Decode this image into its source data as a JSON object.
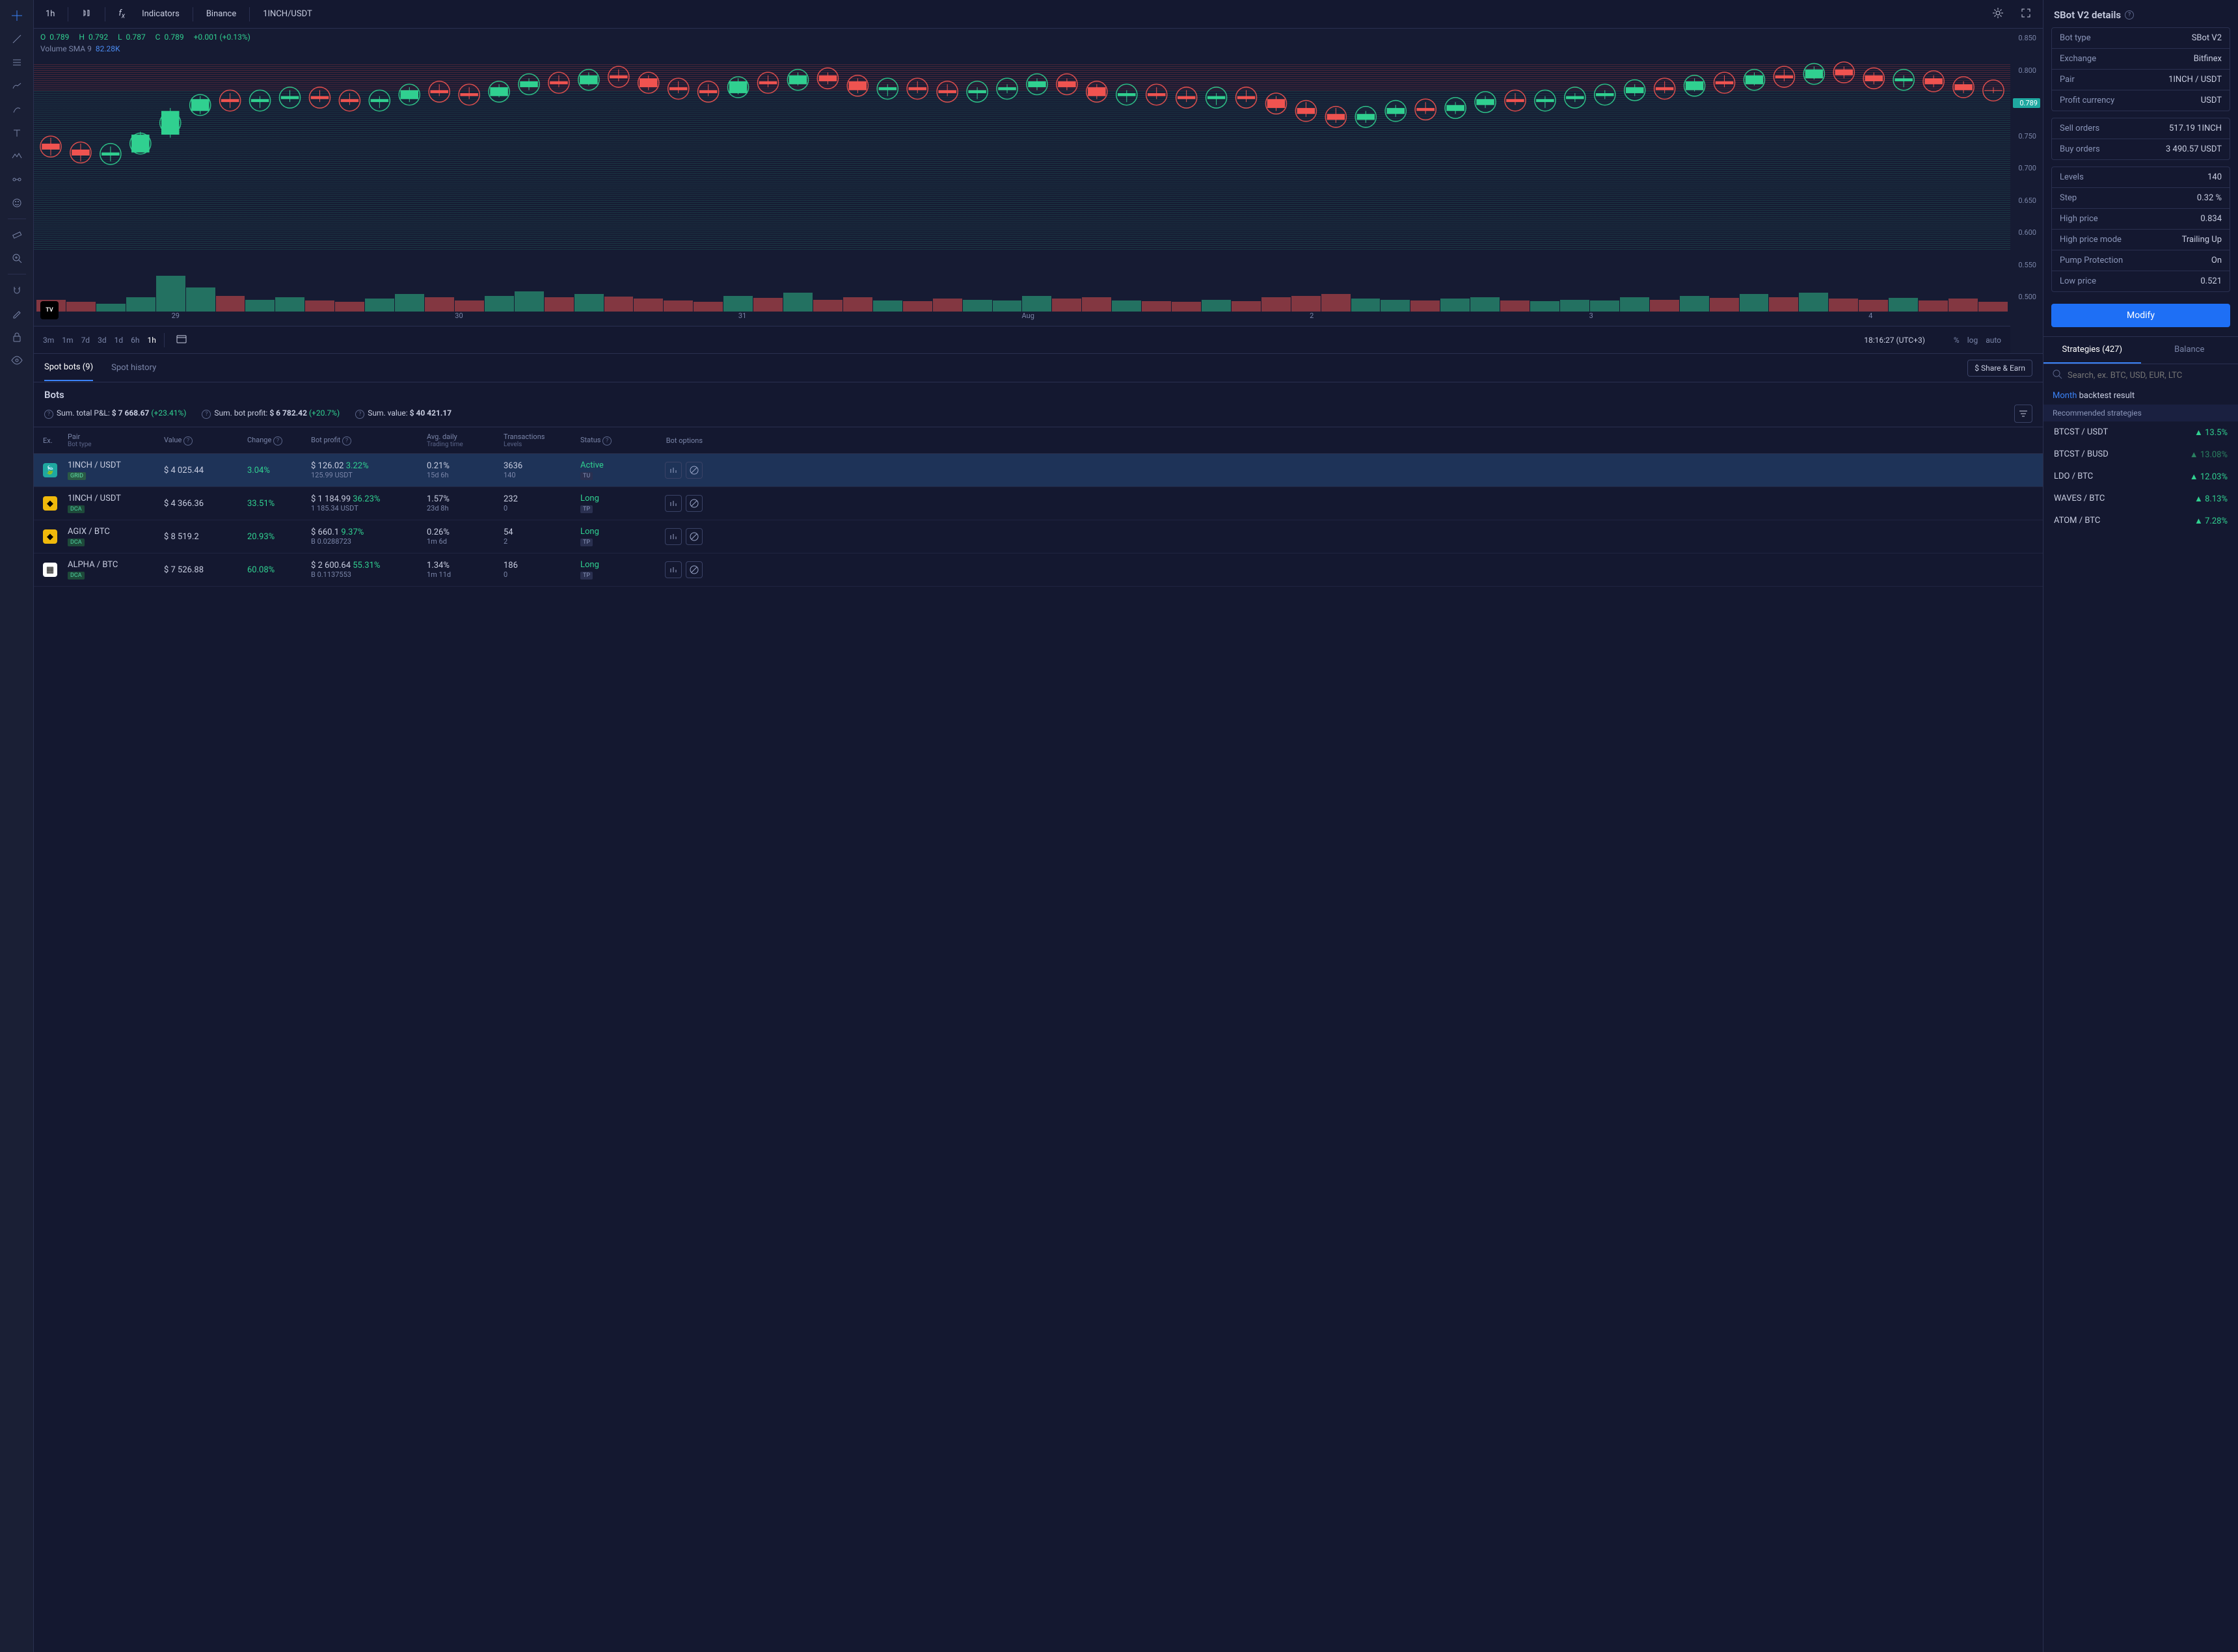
{
  "toolbar": {
    "interval": "1h",
    "indicators": "Indicators",
    "exchange": "Binance",
    "pair": "1INCH/USDT"
  },
  "ohlc": {
    "o_label": "O",
    "o": "0.789",
    "h_label": "H",
    "h": "0.792",
    "l_label": "L",
    "l": "0.787",
    "c_label": "C",
    "c": "0.789",
    "change": "+0.001 (+0.13%)"
  },
  "volume": {
    "label": "Volume SMA 9",
    "value": "82.28K"
  },
  "y_ticks": [
    "0.850",
    "0.800",
    "0.789",
    "0.750",
    "0.700",
    "0.650",
    "0.600",
    "0.550",
    "0.500"
  ],
  "x_ticks": [
    "29",
    "30",
    "31",
    "Aug",
    "2",
    "3",
    "4"
  ],
  "timeframes": [
    "3m",
    "1m",
    "7d",
    "3d",
    "1d",
    "6h",
    "1h"
  ],
  "clock": "18:16:27 (UTC+3)",
  "axis_opts": {
    "pct": "%",
    "log": "log",
    "auto": "auto"
  },
  "bots_tabs": {
    "spot": "Spot bots (9)",
    "history": "Spot history"
  },
  "share_earn": "$ Share & Earn",
  "bots_title": "Bots",
  "summary": {
    "pnl_label": "Sum. total P&L:",
    "pnl": "$ 7 668.67",
    "pnl_pct": "(+23.41%)",
    "profit_label": "Sum. bot profit:",
    "profit": "$ 6 782.42",
    "profit_pct": "(+20.7%)",
    "value_label": "Sum. value:",
    "value": "$ 40 421.17"
  },
  "columns": {
    "ex": "Ex.",
    "pair": "Pair",
    "pair_sub": "Bot type",
    "value": "Value",
    "change": "Change",
    "profit": "Bot profit",
    "avg": "Avg. daily",
    "avg_sub": "Trading time",
    "tx": "Transactions",
    "tx_sub": "Levels",
    "status": "Status",
    "options": "Bot options"
  },
  "rows": [
    {
      "ex_color": "#1fa8a0",
      "ex_glyph": "🍃",
      "pair": "1INCH / USDT",
      "type": "GRID",
      "value": "$ 4 025.44",
      "change": "3.04%",
      "profit": "$ 126.02",
      "profit_pct": "3.22%",
      "profit_sub": "125.99 USDT",
      "avg": "0.21%",
      "time": "15d 6h",
      "tx": "3636",
      "levels": "140",
      "status": "Active",
      "status_badge": "TU",
      "selected": true
    },
    {
      "ex_color": "#f0b90b",
      "ex_glyph": "◆",
      "pair": "1INCH / USDT",
      "type": "DCA",
      "value": "$ 4 366.36",
      "change": "33.51%",
      "profit": "$ 1 184.99",
      "profit_pct": "36.23%",
      "profit_sub": "1 185.34 USDT",
      "avg": "1.57%",
      "time": "23d 8h",
      "tx": "232",
      "levels": "0",
      "status": "Long",
      "status_badge": "TP",
      "selected": false
    },
    {
      "ex_color": "#f0b90b",
      "ex_glyph": "◆",
      "pair": "AGIX / BTC",
      "type": "DCA",
      "value": "$ 8 519.2",
      "change": "20.93%",
      "profit": "$ 660.1",
      "profit_pct": "9.37%",
      "profit_sub": "B 0.0288723",
      "avg": "0.26%",
      "time": "1m 6d",
      "tx": "54",
      "levels": "2",
      "status": "Long",
      "status_badge": "TP",
      "selected": false
    },
    {
      "ex_color": "#ffffff",
      "ex_glyph": "▦",
      "pair": "ALPHA / BTC",
      "type": "DCA",
      "value": "$ 7 526.88",
      "change": "60.08%",
      "profit": "$ 2 600.64",
      "profit_pct": "55.31%",
      "profit_sub": "B 0.1137553",
      "avg": "1.34%",
      "time": "1m 11d",
      "tx": "186",
      "levels": "0",
      "status": "Long",
      "status_badge": "TP",
      "selected": false
    }
  ],
  "details": {
    "title": "SBot V2 details",
    "groups": [
      [
        {
          "lbl": "Bot type",
          "val": "SBot V2"
        },
        {
          "lbl": "Exchange",
          "val": "Bitfinex"
        },
        {
          "lbl": "Pair",
          "val": "1INCH / USDT"
        },
        {
          "lbl": "Profit currency",
          "val": "USDT"
        }
      ],
      [
        {
          "lbl": "Sell orders",
          "val": "517.19 1INCH"
        },
        {
          "lbl": "Buy orders",
          "val": "3 490.57 USDT"
        }
      ],
      [
        {
          "lbl": "Levels",
          "val": "140"
        },
        {
          "lbl": "Step",
          "val": "0.32 %"
        },
        {
          "lbl": "High price",
          "val": "0.834"
        },
        {
          "lbl": "High price mode",
          "val": "Trailing Up"
        },
        {
          "lbl": "Pump Protection",
          "val": "On"
        },
        {
          "lbl": "Low price",
          "val": "0.521"
        }
      ]
    ],
    "modify": "Modify"
  },
  "strategies": {
    "tab1": "Strategies (427)",
    "tab2": "Balance",
    "search_placeholder": "Search, ex. BTC, USD, EUR, LTC",
    "month": "Month",
    "backtest": "backtest result",
    "rec": "Recommended strategies",
    "list": [
      {
        "pair": "BTCST / USDT",
        "pct": "13.5%",
        "dim": false
      },
      {
        "pair": "BTCST / BUSD",
        "pct": "13.08%",
        "dim": true
      },
      {
        "pair": "LDO / BTC",
        "pct": "12.03%",
        "dim": false
      },
      {
        "pair": "WAVES / BTC",
        "pct": "8.13%",
        "dim": false
      },
      {
        "pair": "ATOM / BTC",
        "pct": "7.28%",
        "dim": false
      }
    ]
  },
  "chart_data": {
    "type": "candlestick-grid-bot",
    "price_range": [
      0.5,
      0.85
    ],
    "current_price": 0.789,
    "grid_sell_zone": [
      0.789,
      0.834
    ],
    "grid_buy_zone": [
      0.521,
      0.789
    ],
    "candles": [
      {
        "t": 0,
        "o": 0.7,
        "h": 0.71,
        "l": 0.68,
        "c": 0.69,
        "v": 15
      },
      {
        "t": 1,
        "o": 0.69,
        "h": 0.7,
        "l": 0.67,
        "c": 0.68,
        "v": 12
      },
      {
        "t": 2,
        "o": 0.68,
        "h": 0.695,
        "l": 0.67,
        "c": 0.685,
        "v": 10
      },
      {
        "t": 3,
        "o": 0.685,
        "h": 0.72,
        "l": 0.685,
        "c": 0.715,
        "v": 18
      },
      {
        "t": 4,
        "o": 0.715,
        "h": 0.76,
        "l": 0.71,
        "c": 0.755,
        "v": 45
      },
      {
        "t": 5,
        "o": 0.755,
        "h": 0.78,
        "l": 0.75,
        "c": 0.775,
        "v": 30
      },
      {
        "t": 6,
        "o": 0.775,
        "h": 0.785,
        "l": 0.76,
        "c": 0.77,
        "v": 20
      },
      {
        "t": 7,
        "o": 0.77,
        "h": 0.78,
        "l": 0.76,
        "c": 0.775,
        "v": 15
      },
      {
        "t": 8,
        "o": 0.775,
        "h": 0.79,
        "l": 0.77,
        "c": 0.78,
        "v": 18
      },
      {
        "t": 9,
        "o": 0.78,
        "h": 0.79,
        "l": 0.77,
        "c": 0.775,
        "v": 14
      },
      {
        "t": 10,
        "o": 0.775,
        "h": 0.785,
        "l": 0.765,
        "c": 0.77,
        "v": 12
      },
      {
        "t": 11,
        "o": 0.77,
        "h": 0.78,
        "l": 0.76,
        "c": 0.775,
        "v": 16
      },
      {
        "t": 12,
        "o": 0.775,
        "h": 0.795,
        "l": 0.77,
        "c": 0.79,
        "v": 22
      },
      {
        "t": 13,
        "o": 0.79,
        "h": 0.8,
        "l": 0.78,
        "c": 0.785,
        "v": 18
      },
      {
        "t": 14,
        "o": 0.785,
        "h": 0.795,
        "l": 0.775,
        "c": 0.78,
        "v": 14
      },
      {
        "t": 15,
        "o": 0.78,
        "h": 0.8,
        "l": 0.778,
        "c": 0.795,
        "v": 20
      },
      {
        "t": 16,
        "o": 0.795,
        "h": 0.81,
        "l": 0.79,
        "c": 0.805,
        "v": 25
      },
      {
        "t": 17,
        "o": 0.805,
        "h": 0.815,
        "l": 0.795,
        "c": 0.8,
        "v": 18
      },
      {
        "t": 18,
        "o": 0.8,
        "h": 0.82,
        "l": 0.798,
        "c": 0.815,
        "v": 22
      },
      {
        "t": 19,
        "o": 0.815,
        "h": 0.825,
        "l": 0.805,
        "c": 0.81,
        "v": 19
      },
      {
        "t": 20,
        "o": 0.81,
        "h": 0.815,
        "l": 0.79,
        "c": 0.795,
        "v": 16
      },
      {
        "t": 21,
        "o": 0.795,
        "h": 0.805,
        "l": 0.785,
        "c": 0.79,
        "v": 14
      },
      {
        "t": 22,
        "o": 0.79,
        "h": 0.8,
        "l": 0.78,
        "c": 0.785,
        "v": 12
      },
      {
        "t": 23,
        "o": 0.785,
        "h": 0.81,
        "l": 0.783,
        "c": 0.805,
        "v": 20
      },
      {
        "t": 24,
        "o": 0.805,
        "h": 0.815,
        "l": 0.795,
        "c": 0.8,
        "v": 17
      },
      {
        "t": 25,
        "o": 0.8,
        "h": 0.82,
        "l": 0.798,
        "c": 0.815,
        "v": 24
      },
      {
        "t": 26,
        "o": 0.815,
        "h": 0.82,
        "l": 0.8,
        "c": 0.805,
        "v": 15
      },
      {
        "t": 27,
        "o": 0.805,
        "h": 0.81,
        "l": 0.785,
        "c": 0.79,
        "v": 18
      },
      {
        "t": 28,
        "o": 0.79,
        "h": 0.8,
        "l": 0.78,
        "c": 0.795,
        "v": 14
      },
      {
        "t": 29,
        "o": 0.795,
        "h": 0.805,
        "l": 0.785,
        "c": 0.79,
        "v": 13
      },
      {
        "t": 30,
        "o": 0.79,
        "h": 0.8,
        "l": 0.78,
        "c": 0.785,
        "v": 16
      },
      {
        "t": 31,
        "o": 0.785,
        "h": 0.795,
        "l": 0.775,
        "c": 0.79,
        "v": 15
      },
      {
        "t": 32,
        "o": 0.79,
        "h": 0.8,
        "l": 0.785,
        "c": 0.795,
        "v": 14
      },
      {
        "t": 33,
        "o": 0.795,
        "h": 0.81,
        "l": 0.79,
        "c": 0.805,
        "v": 20
      },
      {
        "t": 34,
        "o": 0.805,
        "h": 0.81,
        "l": 0.79,
        "c": 0.795,
        "v": 16
      },
      {
        "t": 35,
        "o": 0.795,
        "h": 0.8,
        "l": 0.775,
        "c": 0.78,
        "v": 18
      },
      {
        "t": 36,
        "o": 0.78,
        "h": 0.79,
        "l": 0.77,
        "c": 0.785,
        "v": 14
      },
      {
        "t": 37,
        "o": 0.785,
        "h": 0.795,
        "l": 0.775,
        "c": 0.78,
        "v": 13
      },
      {
        "t": 38,
        "o": 0.78,
        "h": 0.79,
        "l": 0.77,
        "c": 0.775,
        "v": 12
      },
      {
        "t": 39,
        "o": 0.775,
        "h": 0.785,
        "l": 0.765,
        "c": 0.78,
        "v": 15
      },
      {
        "t": 40,
        "o": 0.78,
        "h": 0.79,
        "l": 0.77,
        "c": 0.775,
        "v": 13
      },
      {
        "t": 41,
        "o": 0.775,
        "h": 0.78,
        "l": 0.755,
        "c": 0.76,
        "v": 18
      },
      {
        "t": 42,
        "o": 0.76,
        "h": 0.77,
        "l": 0.745,
        "c": 0.75,
        "v": 20
      },
      {
        "t": 43,
        "o": 0.75,
        "h": 0.76,
        "l": 0.735,
        "c": 0.74,
        "v": 22
      },
      {
        "t": 44,
        "o": 0.74,
        "h": 0.755,
        "l": 0.735,
        "c": 0.75,
        "v": 16
      },
      {
        "t": 45,
        "o": 0.75,
        "h": 0.765,
        "l": 0.745,
        "c": 0.76,
        "v": 15
      },
      {
        "t": 46,
        "o": 0.76,
        "h": 0.77,
        "l": 0.75,
        "c": 0.755,
        "v": 14
      },
      {
        "t": 47,
        "o": 0.755,
        "h": 0.77,
        "l": 0.75,
        "c": 0.765,
        "v": 16
      },
      {
        "t": 48,
        "o": 0.765,
        "h": 0.78,
        "l": 0.76,
        "c": 0.775,
        "v": 18
      },
      {
        "t": 49,
        "o": 0.775,
        "h": 0.785,
        "l": 0.765,
        "c": 0.77,
        "v": 14
      },
      {
        "t": 50,
        "o": 0.77,
        "h": 0.78,
        "l": 0.76,
        "c": 0.775,
        "v": 13
      },
      {
        "t": 51,
        "o": 0.775,
        "h": 0.785,
        "l": 0.77,
        "c": 0.78,
        "v": 15
      },
      {
        "t": 52,
        "o": 0.78,
        "h": 0.79,
        "l": 0.775,
        "c": 0.785,
        "v": 14
      },
      {
        "t": 53,
        "o": 0.785,
        "h": 0.8,
        "l": 0.78,
        "c": 0.795,
        "v": 18
      },
      {
        "t": 54,
        "o": 0.795,
        "h": 0.805,
        "l": 0.785,
        "c": 0.79,
        "v": 15
      },
      {
        "t": 55,
        "o": 0.79,
        "h": 0.81,
        "l": 0.788,
        "c": 0.805,
        "v": 20
      },
      {
        "t": 56,
        "o": 0.805,
        "h": 0.815,
        "l": 0.795,
        "c": 0.8,
        "v": 17
      },
      {
        "t": 57,
        "o": 0.8,
        "h": 0.82,
        "l": 0.798,
        "c": 0.815,
        "v": 22
      },
      {
        "t": 58,
        "o": 0.815,
        "h": 0.825,
        "l": 0.805,
        "c": 0.81,
        "v": 18
      },
      {
        "t": 59,
        "o": 0.81,
        "h": 0.83,
        "l": 0.808,
        "c": 0.825,
        "v": 24
      },
      {
        "t": 60,
        "o": 0.825,
        "h": 0.83,
        "l": 0.81,
        "c": 0.815,
        "v": 16
      },
      {
        "t": 61,
        "o": 0.815,
        "h": 0.82,
        "l": 0.8,
        "c": 0.805,
        "v": 15
      },
      {
        "t": 62,
        "o": 0.805,
        "h": 0.815,
        "l": 0.795,
        "c": 0.81,
        "v": 17
      },
      {
        "t": 63,
        "o": 0.81,
        "h": 0.815,
        "l": 0.795,
        "c": 0.8,
        "v": 14
      },
      {
        "t": 64,
        "o": 0.8,
        "h": 0.805,
        "l": 0.785,
        "c": 0.79,
        "v": 16
      },
      {
        "t": 65,
        "o": 0.79,
        "h": 0.795,
        "l": 0.785,
        "c": 0.789,
        "v": 12
      }
    ]
  }
}
